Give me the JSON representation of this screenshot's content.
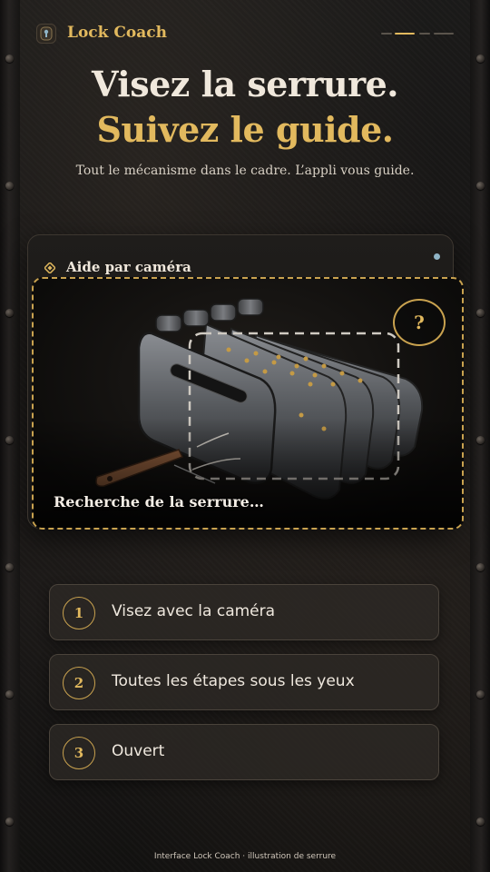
{
  "app": {
    "name": "Lock Coach",
    "logo_icon": "keyhole-icon"
  },
  "header": {
    "progress_steps": 3,
    "active_step": 1,
    "accent": "#e2b95e"
  },
  "hero": {
    "line1": "Visez la serrure.",
    "line2": "Suivez le guide.",
    "subtitle": "Tout le mécanisme dans le cadre. L’appli vous guide."
  },
  "camera_card": {
    "title": "Aide par caméra",
    "title_icon": "diamond-icon",
    "help_label": "?",
    "status": "Recherche de la serrure…",
    "status_dot_color": "#8fb4c6"
  },
  "steps": [
    {
      "number": "1",
      "label": "Visez avec la caméra"
    },
    {
      "number": "2",
      "label": "Toutes les étapes sous les yeux"
    },
    {
      "number": "3",
      "label": "Ouvert"
    }
  ],
  "footer": {
    "caption": "Interface Lock Coach · illustration de serrure"
  },
  "colors": {
    "gold": "#e2b95e",
    "gold_border": "#c9a24f",
    "text_light": "#f0e8dc"
  }
}
